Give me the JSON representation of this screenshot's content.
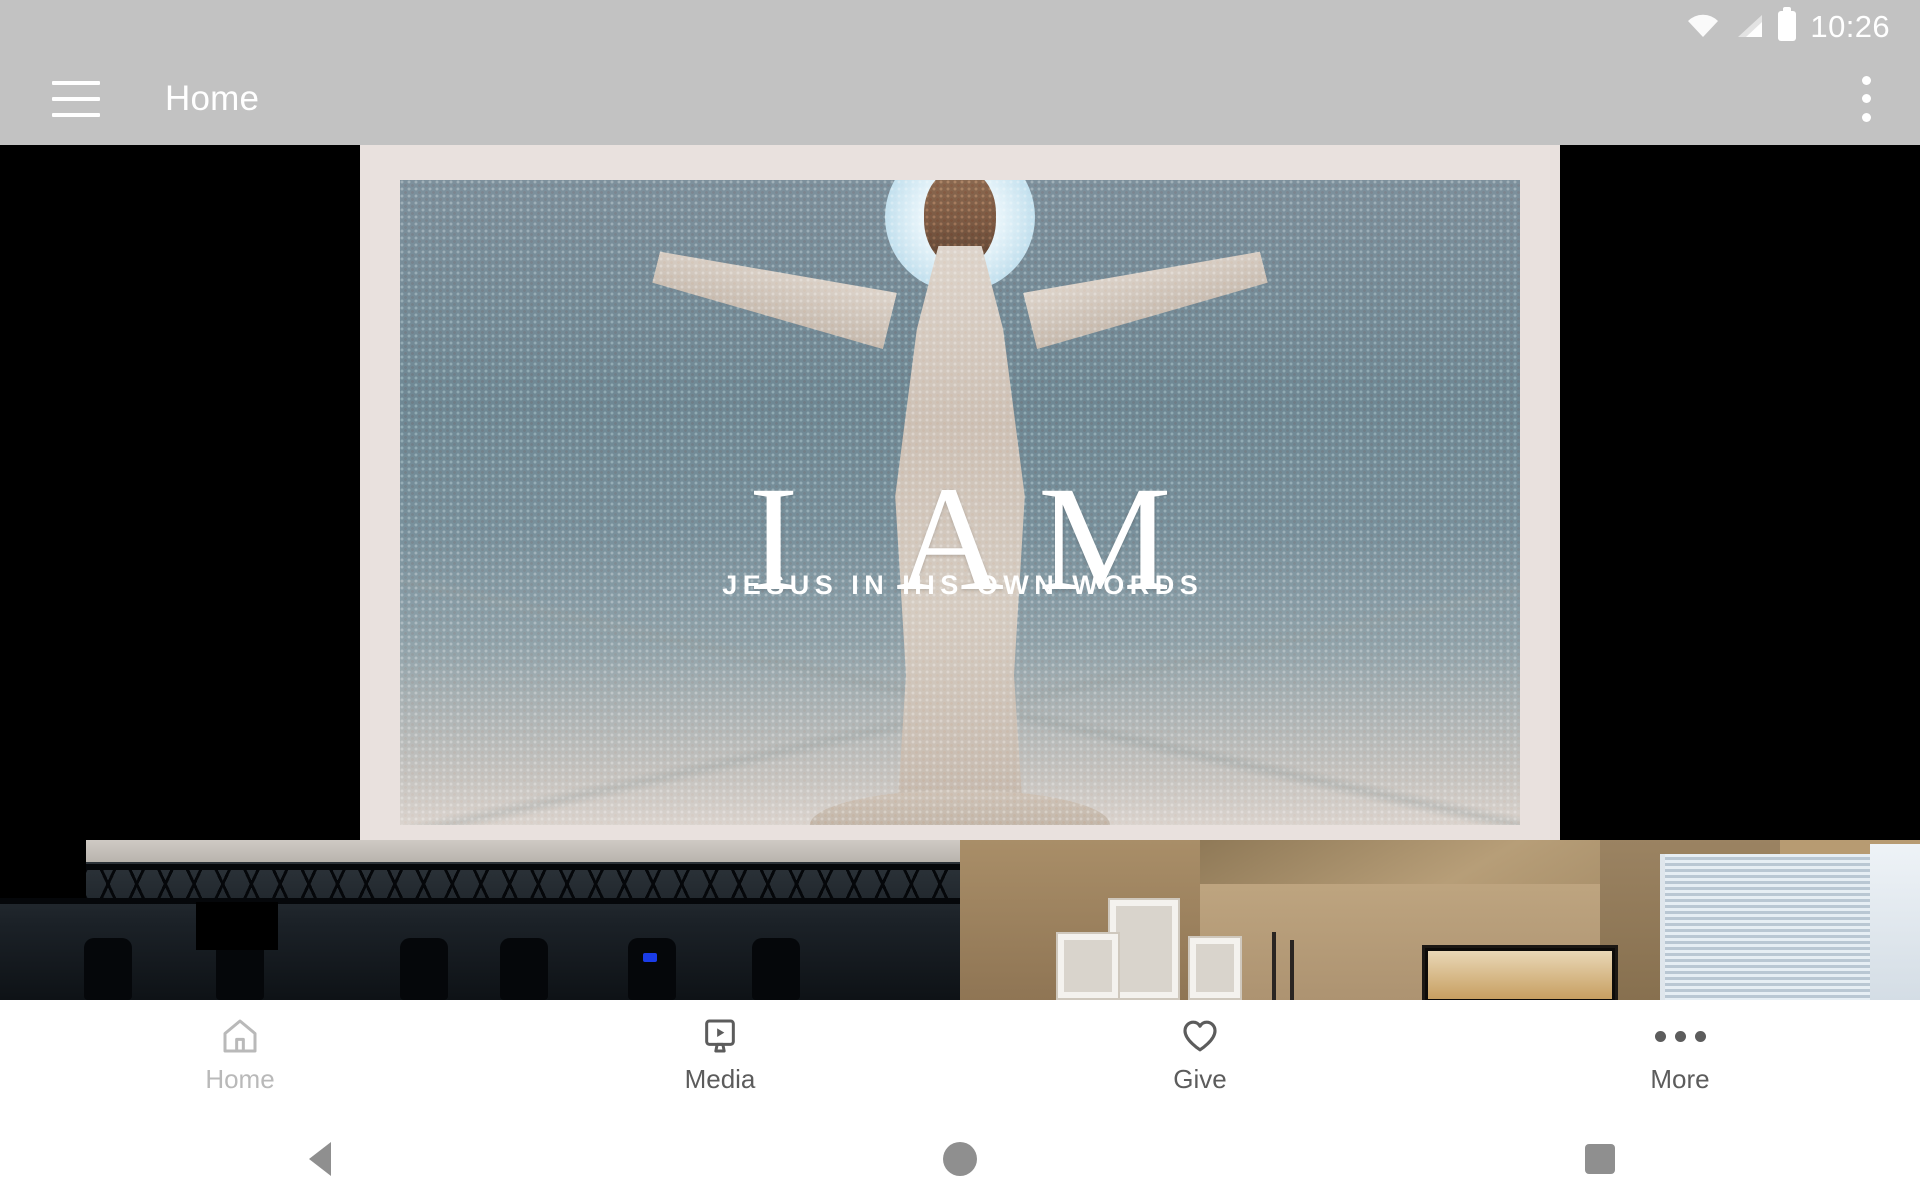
{
  "status_bar": {
    "time": "10:26",
    "icons": [
      "wifi-icon",
      "cellular-signal-icon",
      "battery-icon"
    ]
  },
  "app_bar": {
    "menu_icon": "hamburger-menu-icon",
    "title": "Home",
    "overflow_icon": "overflow-menu-icon"
  },
  "content": {
    "hero_card": {
      "title": "I AM",
      "subtitle": "JESUS IN HIS OWN WORDS",
      "card_bg": "#e9e1de",
      "image_alt": "halftone-artwork-of-jesus-with-outstretched-arms"
    },
    "tiles": [
      {
        "name": "stage-lighting-truss-photo"
      },
      {
        "name": "living-room-with-tv-and-window-blinds-photo"
      }
    ]
  },
  "bottom_nav": {
    "items": [
      {
        "label": "Home",
        "icon": "home-icon",
        "active": true
      },
      {
        "label": "Media",
        "icon": "media-player-icon",
        "active": false
      },
      {
        "label": "Give",
        "icon": "heart-icon",
        "active": false
      },
      {
        "label": "More",
        "icon": "more-dots-icon",
        "active": false
      }
    ]
  },
  "system_nav": {
    "back": "back-triangle-icon",
    "home": "home-circle-icon",
    "recents": "recents-square-icon"
  },
  "colors": {
    "app_bar": "#c2c2c2",
    "nav_bg": "#ffffff",
    "inactive": "#b9b9b9",
    "icon": "#5c5c5c"
  }
}
